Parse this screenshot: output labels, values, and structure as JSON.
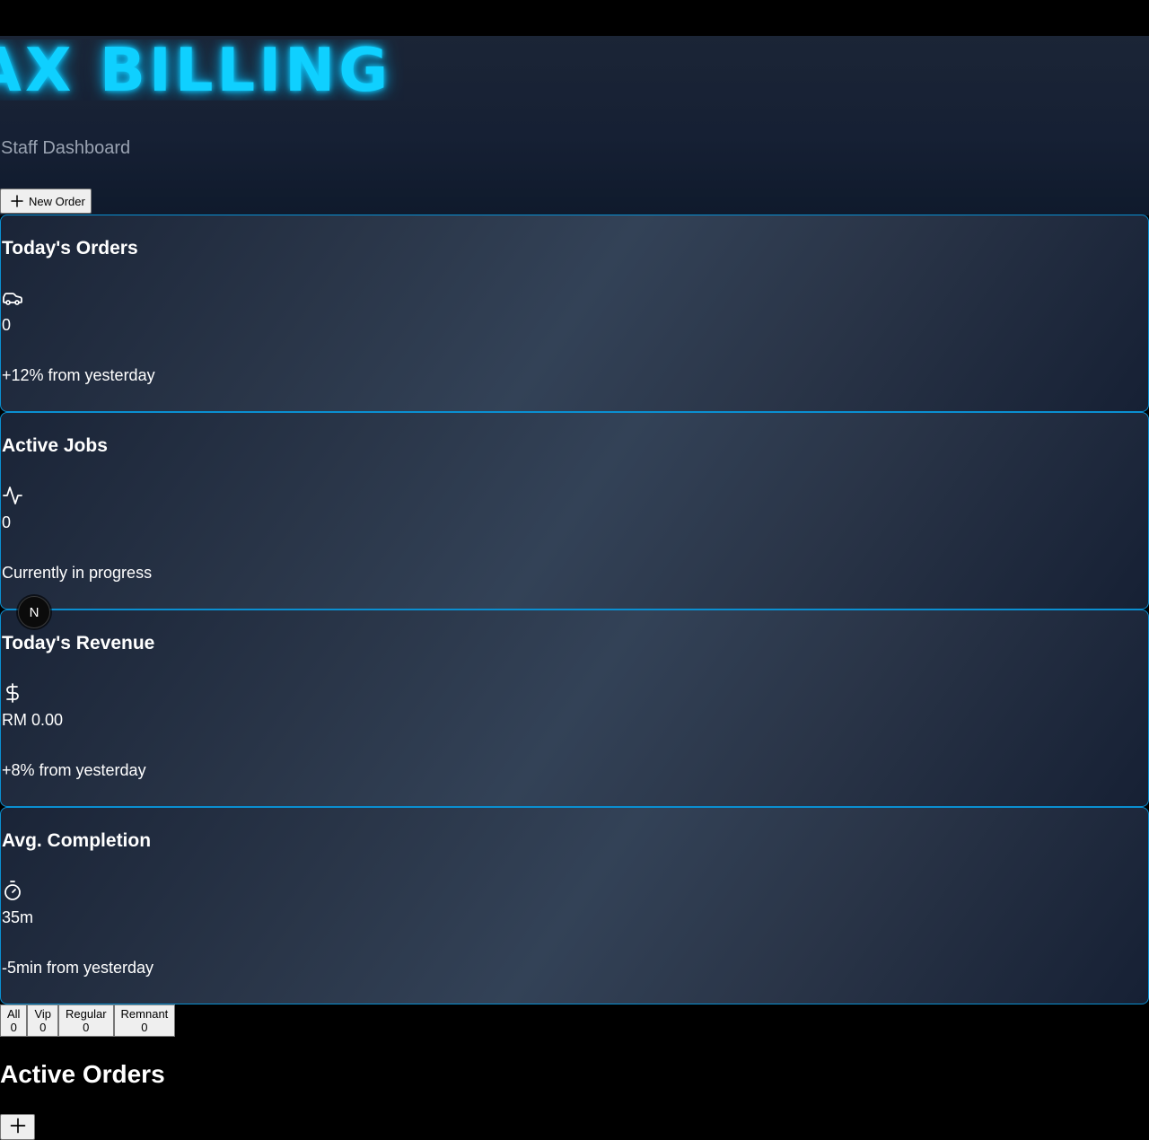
{
  "app": {
    "brand": "AX BILLING",
    "subtitle": "Staff Dashboard"
  },
  "toolbar": {
    "new_order_label": "New Order",
    "new_order_icon": "plus-icon"
  },
  "stats": [
    {
      "title": "Today's Orders",
      "icon": "car-icon",
      "value": "0",
      "note": "+12% from yesterday"
    },
    {
      "title": "Active Jobs",
      "icon": "activity-icon",
      "value": "0",
      "note": "Currently in progress"
    },
    {
      "title": "Today's Revenue",
      "icon": "dollar-sign-icon",
      "value": "RM 0.00",
      "note": "+8% from yesterday"
    },
    {
      "title": "Avg. Completion",
      "icon": "timer-icon",
      "value": "35m",
      "note": "-5min from yesterday"
    }
  ],
  "badge": {
    "letter": "N"
  },
  "filters": [
    {
      "label": "All",
      "count": "0"
    },
    {
      "label": "Vip",
      "count": "0"
    },
    {
      "label": "Regular",
      "count": "0"
    },
    {
      "label": "Remnant",
      "count": "0"
    }
  ],
  "orders": {
    "title": "Active Orders",
    "add_icon": "plus-icon"
  },
  "colors": {
    "accent": "#0fd0ff",
    "card_border": "#0a8fd1",
    "background": "#000000"
  }
}
